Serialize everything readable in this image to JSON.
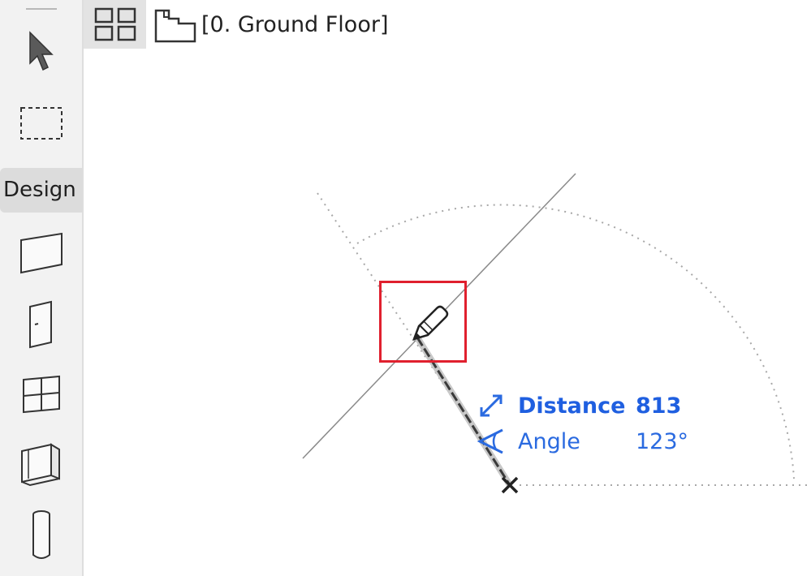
{
  "toolbox": {
    "tools": [
      {
        "name": "arrow-tool",
        "icon": "arrow-pointer-icon"
      },
      {
        "name": "marquee-tool",
        "icon": "dashed-rectangle-icon"
      },
      {
        "name": "slab-tool",
        "icon": "slab-icon"
      },
      {
        "name": "door-tool",
        "icon": "door-icon"
      },
      {
        "name": "window-tool",
        "icon": "window-icon"
      },
      {
        "name": "wall-tool",
        "icon": "wall-icon"
      },
      {
        "name": "column-tool",
        "icon": "column-icon"
      }
    ],
    "design_tab_label": "Design"
  },
  "tabs": {
    "view_icon": "grid-view-icon",
    "floor_icon": "floor-plan-icon",
    "floor_label": "[0. Ground Floor]"
  },
  "tracker": {
    "distance_label": "Distance",
    "distance_value": "813",
    "angle_label": "Angle",
    "angle_value": "123°"
  },
  "colors": {
    "tracker_blue": "#2a6ae0",
    "highlight_red": "#e0202e",
    "toolbox_bg": "#f2f2f2"
  }
}
